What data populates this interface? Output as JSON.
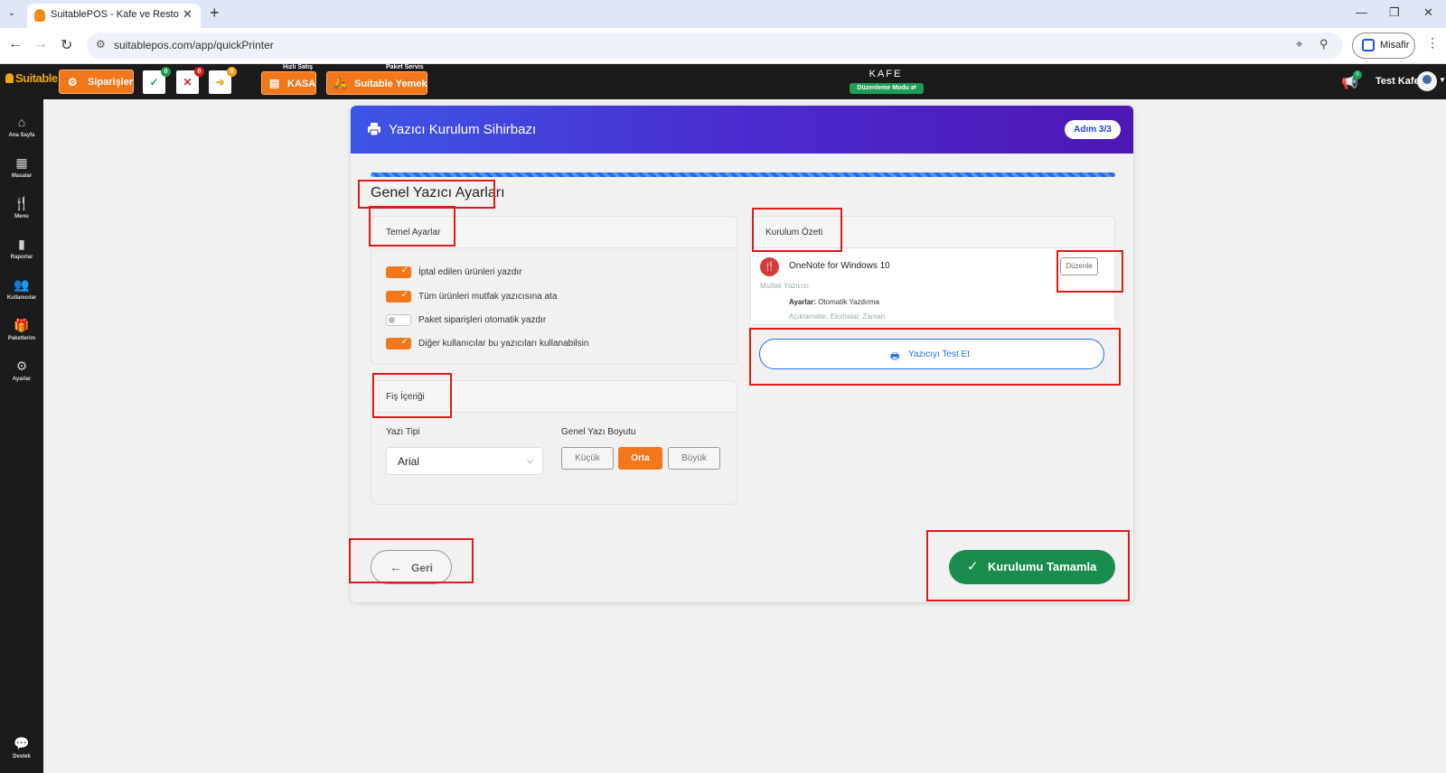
{
  "browser": {
    "tab_title": "SuitablePOS - Kafe ve Restoran",
    "url": "suitablepos.com/app/quickPrinter",
    "guest_label": "Misafir"
  },
  "header": {
    "logo_text": "Suitable",
    "orders_label": "Siparişler",
    "badge_green": "0",
    "badge_red": "0",
    "badge_yellow": "0",
    "quick_sale_caption": "Hızlı Satış",
    "kasa_label": "KASA",
    "package_caption": "Paket Servis",
    "suitable_yemek_label": "Suitable Yemek",
    "venue_title": "KAFE",
    "edit_mode_label": "Düzenleme Modu",
    "notif_badge": "0",
    "user_name": "Test Kafe"
  },
  "sidebar": {
    "items": [
      {
        "label": "Ana Sayfa",
        "icon": "home-icon"
      },
      {
        "label": "Masalar",
        "icon": "table-icon"
      },
      {
        "label": "Menu",
        "icon": "cutlery-icon"
      },
      {
        "label": "Raporlar",
        "icon": "report-icon"
      },
      {
        "label": "Kullanıcılar",
        "icon": "users-icon"
      },
      {
        "label": "Paketlerim",
        "icon": "gift-icon"
      },
      {
        "label": "Ayarlar",
        "icon": "gears-icon"
      }
    ],
    "support_label": "Destek"
  },
  "wizard": {
    "title": "Yazıcı Kurulum Sihirbazı",
    "step": "Adım 3/3",
    "section_title": "Genel Yazıcı Ayarları",
    "basic": {
      "title": "Temel Ayarlar",
      "toggles": [
        {
          "label": "İptal edilen ürünleri yazdır",
          "on": true
        },
        {
          "label": "Tüm ürünleri mutfak yazıcısına ata",
          "on": true
        },
        {
          "label": "Paket siparişleri otomatik yazdır",
          "on": false
        },
        {
          "label": "Diğer kullanıcılar bu yazıcıları kullanabilsin",
          "on": true
        }
      ]
    },
    "receipt": {
      "title": "Fiş İçeriği",
      "font_label": "Yazı Tipi",
      "font_value": "Arial",
      "size_label": "Genel Yazı Boyutu",
      "sizes": [
        "Küçük",
        "Orta",
        "Büyük"
      ],
      "selected_size": "Orta"
    },
    "summary": {
      "title": "Kurulum Özeti",
      "printer_name": "OneNote for Windows 10",
      "printer_type": "Mutfak Yazıcısı",
      "settings_key": "Ayarlar:",
      "settings_value": "Otomatik Yazdırma",
      "settings_sub": "Açıklamalar, Ekstralar, Zaman",
      "edit_label": "Düzenle",
      "test_label": "Yazıcıyı Test Et"
    },
    "back_label": "Geri",
    "finish_label": "Kurulumu Tamamla"
  },
  "colors": {
    "accent_orange": "#f2761a",
    "primary_blue": "#1f6fe8",
    "success_green": "#1a8c4e",
    "annotation_red": "#dd1b1b"
  }
}
